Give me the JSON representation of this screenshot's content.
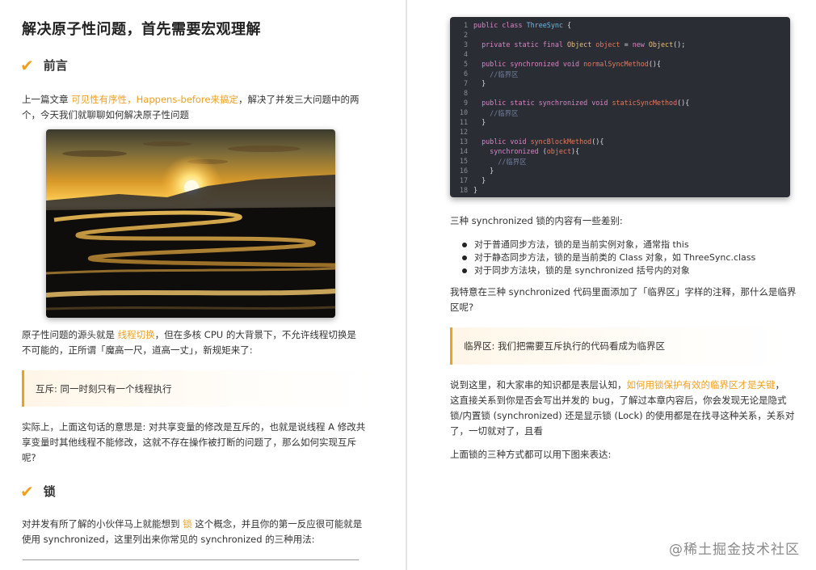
{
  "left": {
    "title": "解决原子性问题，首先需要宏观理解",
    "sec1": "前言",
    "p1_a": "上一篇文章 ",
    "p1_link": "可见性有序性，Happens-before来搞定",
    "p1_b": "，解决了并发三大问题中的两",
    "p1_line2": "个，今天我们就聊聊如何解决原子性问题",
    "p2_a": "原子性问题的源头就是 ",
    "p2_hl": "线程切换",
    "p2_b": "，但在多核 CPU 的大背景下，不允许线程切换是",
    "p2_line2": "不可能的，正所谓「魔高一尺，道高一丈」，新规矩来了:",
    "quote": "互斥: 同一时刻只有一个线程执行",
    "p3_line1": "实际上，上面这句话的意思是: 对共享变量的修改是互斥的，也就是说线程 A 修改共",
    "p3_line2": "享变量时其他线程不能修改，这就不存在操作被打断的问题了，那么如何实现互斥",
    "p3_line3": "呢?",
    "sec2": "锁",
    "p4_a": "对并发有所了解的小伙伴马上就能想到 ",
    "p4_hl": "锁",
    "p4_b": " 这个概念，并且你的第一反应很可能就是",
    "p4_line2": "使用 synchronized，这里列出来你常见的 synchronized 的三种用法:"
  },
  "code": {
    "numbers": [
      "1",
      "2",
      "3",
      "4",
      "5",
      "6",
      "7",
      "8",
      "9",
      "10",
      "11",
      "12",
      "13",
      "14",
      "15",
      "16",
      "17",
      "18"
    ],
    "l1_kw": "public class ",
    "l1_cls": "ThreeSync",
    "l1_pl": " {",
    "l3_kw": "  private static final ",
    "l3_ty": "Object ",
    "l3_fn": "object",
    "l3_pl1": " = ",
    "l3_kw2": "new ",
    "l3_ty2": "Object",
    "l3_pl2": "();",
    "l5_kw": "  public synchronized void ",
    "l5_fn": "normalSyncMethod",
    "l5_pl": "(){",
    "l6_cm": "    //临界区",
    "l7_pl": "  }",
    "l9_kw": "  public static synchronized void ",
    "l9_fn": "staticSyncMethod",
    "l9_pl": "(){",
    "l10_cm": "    //临界区",
    "l11_pl": "  }",
    "l13_kw": "  public void ",
    "l13_fn": "syncBlockMethod",
    "l13_pl": "(){",
    "l14_kw": "    synchronized ",
    "l14_pl1": "(",
    "l14_fn": "object",
    "l14_pl2": "){",
    "l15_cm": "      //临界区",
    "l16_pl": "    }",
    "l17_pl": "  }",
    "l18_pl": "}"
  },
  "right": {
    "intro": "三种 synchronized 锁的内容有一些差别:",
    "bullets": [
      "对于普通同步方法，锁的是当前实例对象，通常指 this",
      "对于静态同步方法，锁的是当前类的 Class 对象，如 ThreeSync.class",
      "对于同步方法块，锁的是 synchronized 括号内的对象"
    ],
    "p1_line1": "我特意在三种 synchronized 代码里面添加了「临界区」字样的注释，那什么是临界",
    "p1_line2": "区呢?",
    "quote": "临界区: 我们把需要互斥执行的代码看成为临界区",
    "p2_a": "说到这里，和大家串的知识都是表层认知，",
    "p2_hl": "如何用锁保护有效的临界区才是关键",
    "p2_b": "，",
    "p2_line2": "这直接关系到你是否会写出并发的 bug，了解过本章内容后，你会发现无论是隐式",
    "p2_line3": "锁/内置锁 (synchronized) 还是显示锁 (Lock) 的使用都是在找寻这种关系，关系对",
    "p2_line4": "了，一切就对了，且看",
    "p3": "上面锁的三种方式都可以用下图来表达:",
    "watermark": "@稀土掘金技术社区"
  }
}
